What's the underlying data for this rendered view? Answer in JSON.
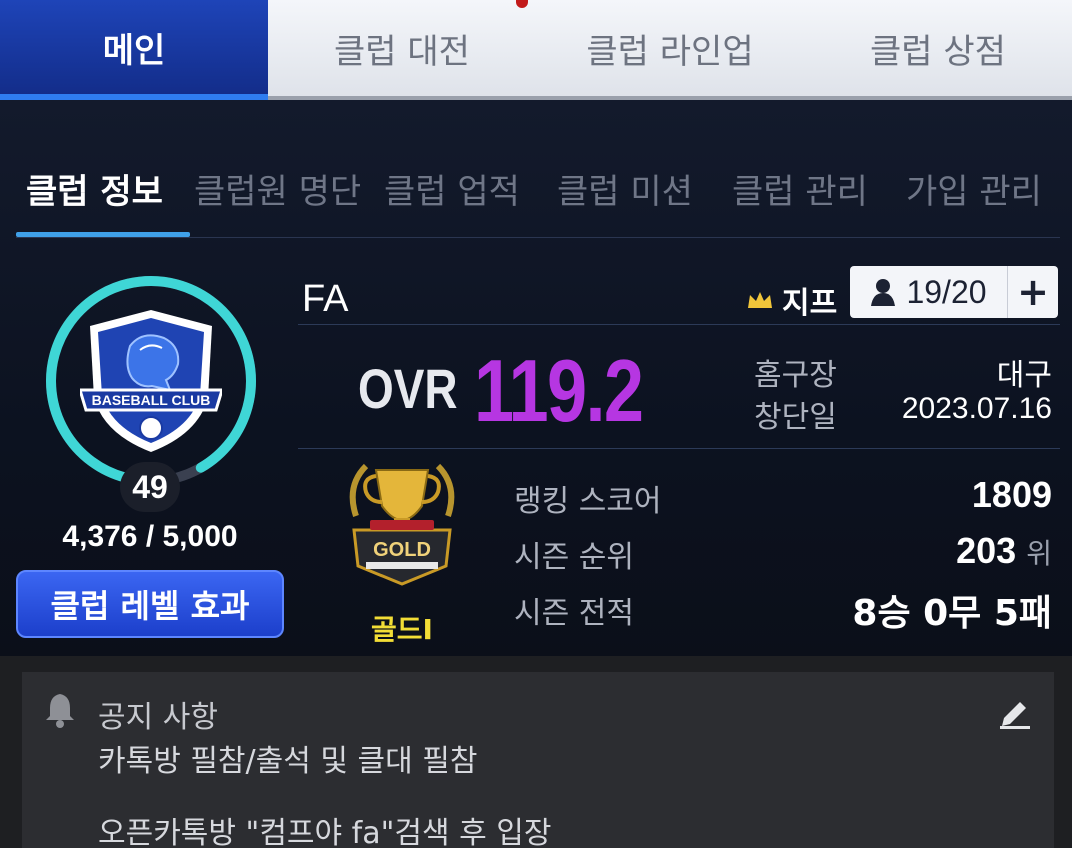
{
  "top_tabs": [
    "메인",
    "클럽 대전",
    "클럽 라인업",
    "클럽 상점"
  ],
  "sub_tabs": [
    "클럽 정보",
    "클럽원 명단",
    "클럽 업적",
    "클럽 미션",
    "클럽 관리",
    "가입 관리"
  ],
  "emblem": {
    "text": "BASEBALL CLUB",
    "level": "49",
    "exp": "4,376 / 5,000",
    "exp_fraction": 0.875
  },
  "level_effect_button": "클럽 레벨 효과",
  "club": {
    "name": "FA",
    "master": "지프",
    "members": "19/20",
    "add_symbol": "+",
    "ovr_label": "OVR",
    "ovr_value": "119.2",
    "home_label": "홈구장",
    "home_value": "대구",
    "founded_label": "창단일",
    "founded_value": "2023.07.16"
  },
  "tier": {
    "name": "골드I",
    "badge_text": "GOLD"
  },
  "stats": {
    "ranking_label": "랭킹 스코어",
    "ranking_value": "1809",
    "rank_label": "시즌 순위",
    "rank_value": "203",
    "rank_unit": "위",
    "record_label": "시즌 전적",
    "record_value": "8승 0무 5패"
  },
  "notice": {
    "title": "공지 사항",
    "line1": "카톡방 필참/출석 및 클대 필참",
    "line2": "오픈카톡방 \"컴프야 fa\"검색 후 입장"
  },
  "colors": {
    "accent_blue": "#1e44b8",
    "ovr": "#b636e2",
    "ring": "#3fd6d6",
    "gold": "#f2dd36"
  }
}
